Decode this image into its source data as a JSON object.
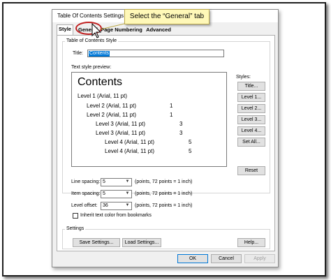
{
  "dialog": {
    "title": "Table Of Contents Settings",
    "tabs": [
      "Style",
      "General",
      "Page Numbering",
      "Advanced"
    ],
    "active_tab": "General"
  },
  "callout": {
    "text": "Select the “General” tab"
  },
  "style_group": {
    "label": "Table of Contents Style",
    "title_label": "Title:",
    "title_value": "Contents",
    "preview_label": "Text style preview:",
    "preview": {
      "heading": "Contents",
      "lines": [
        {
          "text": "Level 1 (Arial, 11 pt)",
          "page": ""
        },
        {
          "text": "Level 2 (Arial, 11 pt)",
          "page": "1"
        },
        {
          "text": "Level 2 (Arial, 11 pt)",
          "page": "1"
        },
        {
          "text": "Level 3 (Arial, 11 pt)",
          "page": "3"
        },
        {
          "text": "Level 3 (Arial, 11 pt)",
          "page": "3"
        },
        {
          "text": "Level 4 (Arial, 11 pt)",
          "page": "5"
        },
        {
          "text": "Level 4 (Arial, 11 pt)",
          "page": "5"
        }
      ]
    },
    "styles_label": "Styles:",
    "style_buttons": [
      "Title...",
      "Level 1...",
      "Level 2...",
      "Level 3...",
      "Level 4...",
      "Set All..."
    ],
    "reset_label": "Reset",
    "line_spacing_label": "Line spacing:",
    "line_spacing_value": "5",
    "item_spacing_label": "Item spacing:",
    "item_spacing_value": "5",
    "level_offset_label": "Level offset:",
    "level_offset_value": "36",
    "points_hint": "(points, 72 points = 1 inch)",
    "inherit_label": "Inherit text color from bookmarks"
  },
  "settings_group": {
    "label": "Settings",
    "save_label": "Save Settings...",
    "load_label": "Load Settings...",
    "help_label": "Help..."
  },
  "footer": {
    "ok": "OK",
    "cancel": "Cancel",
    "apply": "Apply"
  }
}
